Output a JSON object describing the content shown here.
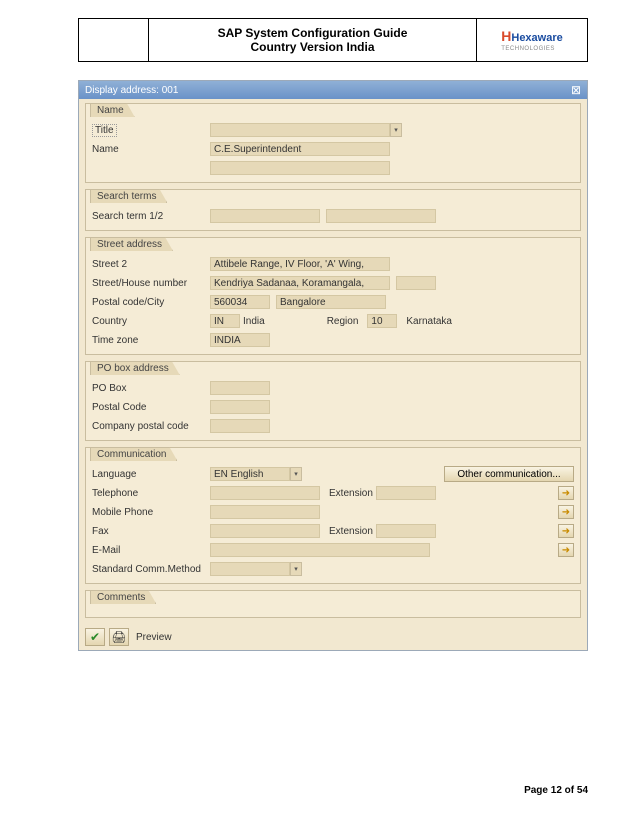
{
  "header": {
    "title_l1": "SAP System Configuration Guide",
    "title_l2": "Country Version India",
    "logo": "Hexaware",
    "logo_sub": "TECHNOLOGIES"
  },
  "window": {
    "title": "Display address: 001"
  },
  "name_group": {
    "legend": "Name",
    "title_label": "Title",
    "name_label": "Name",
    "name_value": "C.E.Superintendent"
  },
  "search_group": {
    "legend": "Search terms",
    "term_label": "Search term 1/2"
  },
  "street_group": {
    "legend": "Street address",
    "street2_label": "Street 2",
    "street2_value": "Attibele Range, IV Floor, 'A' Wing,",
    "house_label": "Street/House number",
    "house_value": "Kendriya Sadanaa, Koramangala,",
    "postal_label": "Postal code/City",
    "postal_value": "560034",
    "city_value": "Bangalore",
    "country_label": "Country",
    "country_code": "IN",
    "country_name": "India",
    "region_label": "Region",
    "region_code": "10",
    "region_name": "Karnataka",
    "tz_label": "Time zone",
    "tz_value": "INDIA"
  },
  "pobox_group": {
    "legend": "PO box address",
    "pobox_label": "PO Box",
    "postal_label": "Postal Code",
    "company_label": "Company postal code"
  },
  "comm_group": {
    "legend": "Communication",
    "lang_label": "Language",
    "lang_value": "EN English",
    "other_btn": "Other communication...",
    "tel_label": "Telephone",
    "ext_label": "Extension",
    "mobile_label": "Mobile Phone",
    "fax_label": "Fax",
    "email_label": "E-Mail",
    "std_label": "Standard Comm.Method"
  },
  "comments_group": {
    "legend": "Comments"
  },
  "toolbar": {
    "preview_label": "Preview"
  },
  "footer": {
    "page": "Page 12 of 54"
  }
}
